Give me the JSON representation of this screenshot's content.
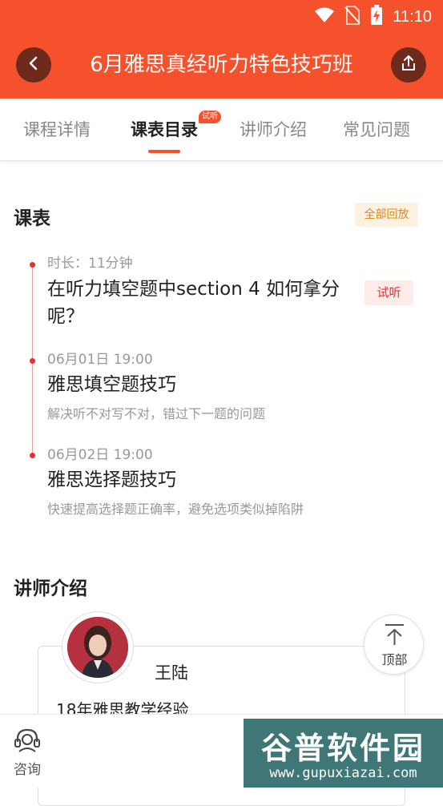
{
  "status_bar": {
    "time": "11:10"
  },
  "header": {
    "title": "6月雅思真经听力特色技巧班"
  },
  "tabs": [
    {
      "label": "课程详情",
      "active": false
    },
    {
      "label": "课表目录",
      "active": true,
      "badge": "试听"
    },
    {
      "label": "讲师介绍",
      "active": false
    },
    {
      "label": "常见问题",
      "active": false
    }
  ],
  "schedule": {
    "title": "课表",
    "replay_all": "全部回放",
    "lessons": [
      {
        "meta": "时长：11分钟",
        "title": "在听力填空题中section 4 如何拿分呢？",
        "title_line1": "在听力填空题中section 4 如何拿分",
        "title_line2": "呢？",
        "badge": "试听"
      },
      {
        "meta": "06月01日 19:00",
        "title": "雅思填空题技巧",
        "desc": "解决听不对写不对，错过下一题的问题"
      },
      {
        "meta": "06月02日 19:00",
        "title": "雅思选择题技巧",
        "desc": "快速提高选择题正确率，避免选项类似掉陷阱"
      }
    ]
  },
  "teachers": {
    "title": "讲师介绍",
    "items": [
      {
        "name": "王陆",
        "experience": "18年雅思教学经验"
      }
    ]
  },
  "back_to_top": "顶部",
  "bottom_bar": {
    "consult_label": "咨询"
  },
  "watermark": {
    "main": "谷普软件园",
    "sub": "www.gupuxiazai.com"
  },
  "colors": {
    "brand": "#f4512c",
    "trial_red": "#e8302a",
    "replay_orange": "#e0871b"
  }
}
